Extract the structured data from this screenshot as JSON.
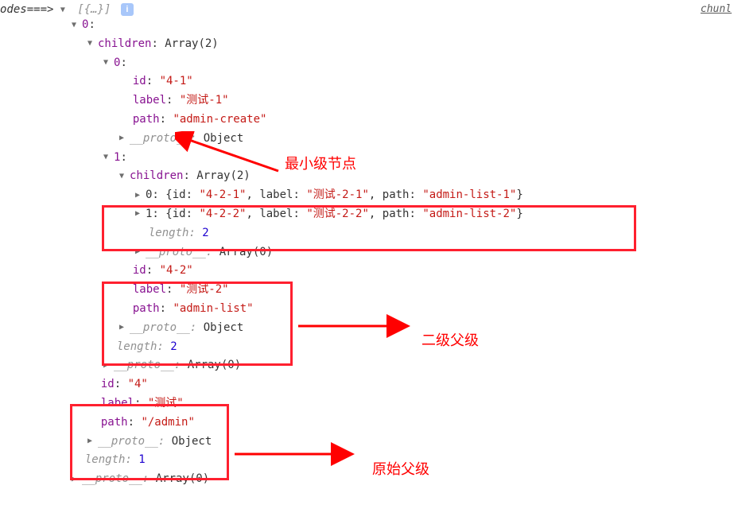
{
  "header": {
    "prefix": "odes===>",
    "summaryBracket": "[{…}]",
    "infoIcon": "i",
    "rightLink": "chunl"
  },
  "tree": {
    "root": {
      "index": "0",
      "childrenLabel": "children",
      "childrenType": "Array(2)",
      "child0": {
        "index": "0",
        "idKey": "id",
        "idVal": "\"4-1\"",
        "labelKey": "label",
        "labelVal": "\"测试-1\"",
        "pathKey": "path",
        "pathVal": "\"admin-create\"",
        "protoKey": "__proto__",
        "protoVal": "Object"
      },
      "child1": {
        "index": "1",
        "childrenLabel": "children",
        "childrenType": "Array(2)",
        "gc0Prefix": "0: ",
        "gc0": "{id: \"4-2-1\", label: \"测试-2-1\", path: \"admin-list-1\"}",
        "gc1Prefix": "1: ",
        "gc1": "{id: \"4-2-2\", label: \"测试-2-2\", path: \"admin-list-2\"}",
        "lenKey": "length",
        "lenVal": "2",
        "protoKey": "__proto__",
        "protoVal": "Array(0)",
        "idKey": "id",
        "idVal": "\"4-2\"",
        "labelKey": "label",
        "labelVal": "\"测试-2\"",
        "pathKey": "path",
        "pathVal": "\"admin-list\"",
        "proto2Key": "__proto__",
        "proto2Val": "Object"
      },
      "lenKey": "length",
      "lenVal": "2",
      "protoKey": "__proto__",
      "protoVal": "Array(0)",
      "idKey": "id",
      "idVal": "\"4\"",
      "labelKey": "label",
      "labelVal": "\"测试\"",
      "pathKey": "path",
      "pathVal": "\"/admin\"",
      "proto2Key": "__proto__",
      "proto2Val": "Object"
    },
    "outerLenKey": "length",
    "outerLenVal": "1",
    "outerProtoKey": "__proto__",
    "outerProtoVal": "Array(0)"
  },
  "annotations": {
    "leaf": "最小级节点",
    "second": "二级父级",
    "origin": "原始父级"
  }
}
